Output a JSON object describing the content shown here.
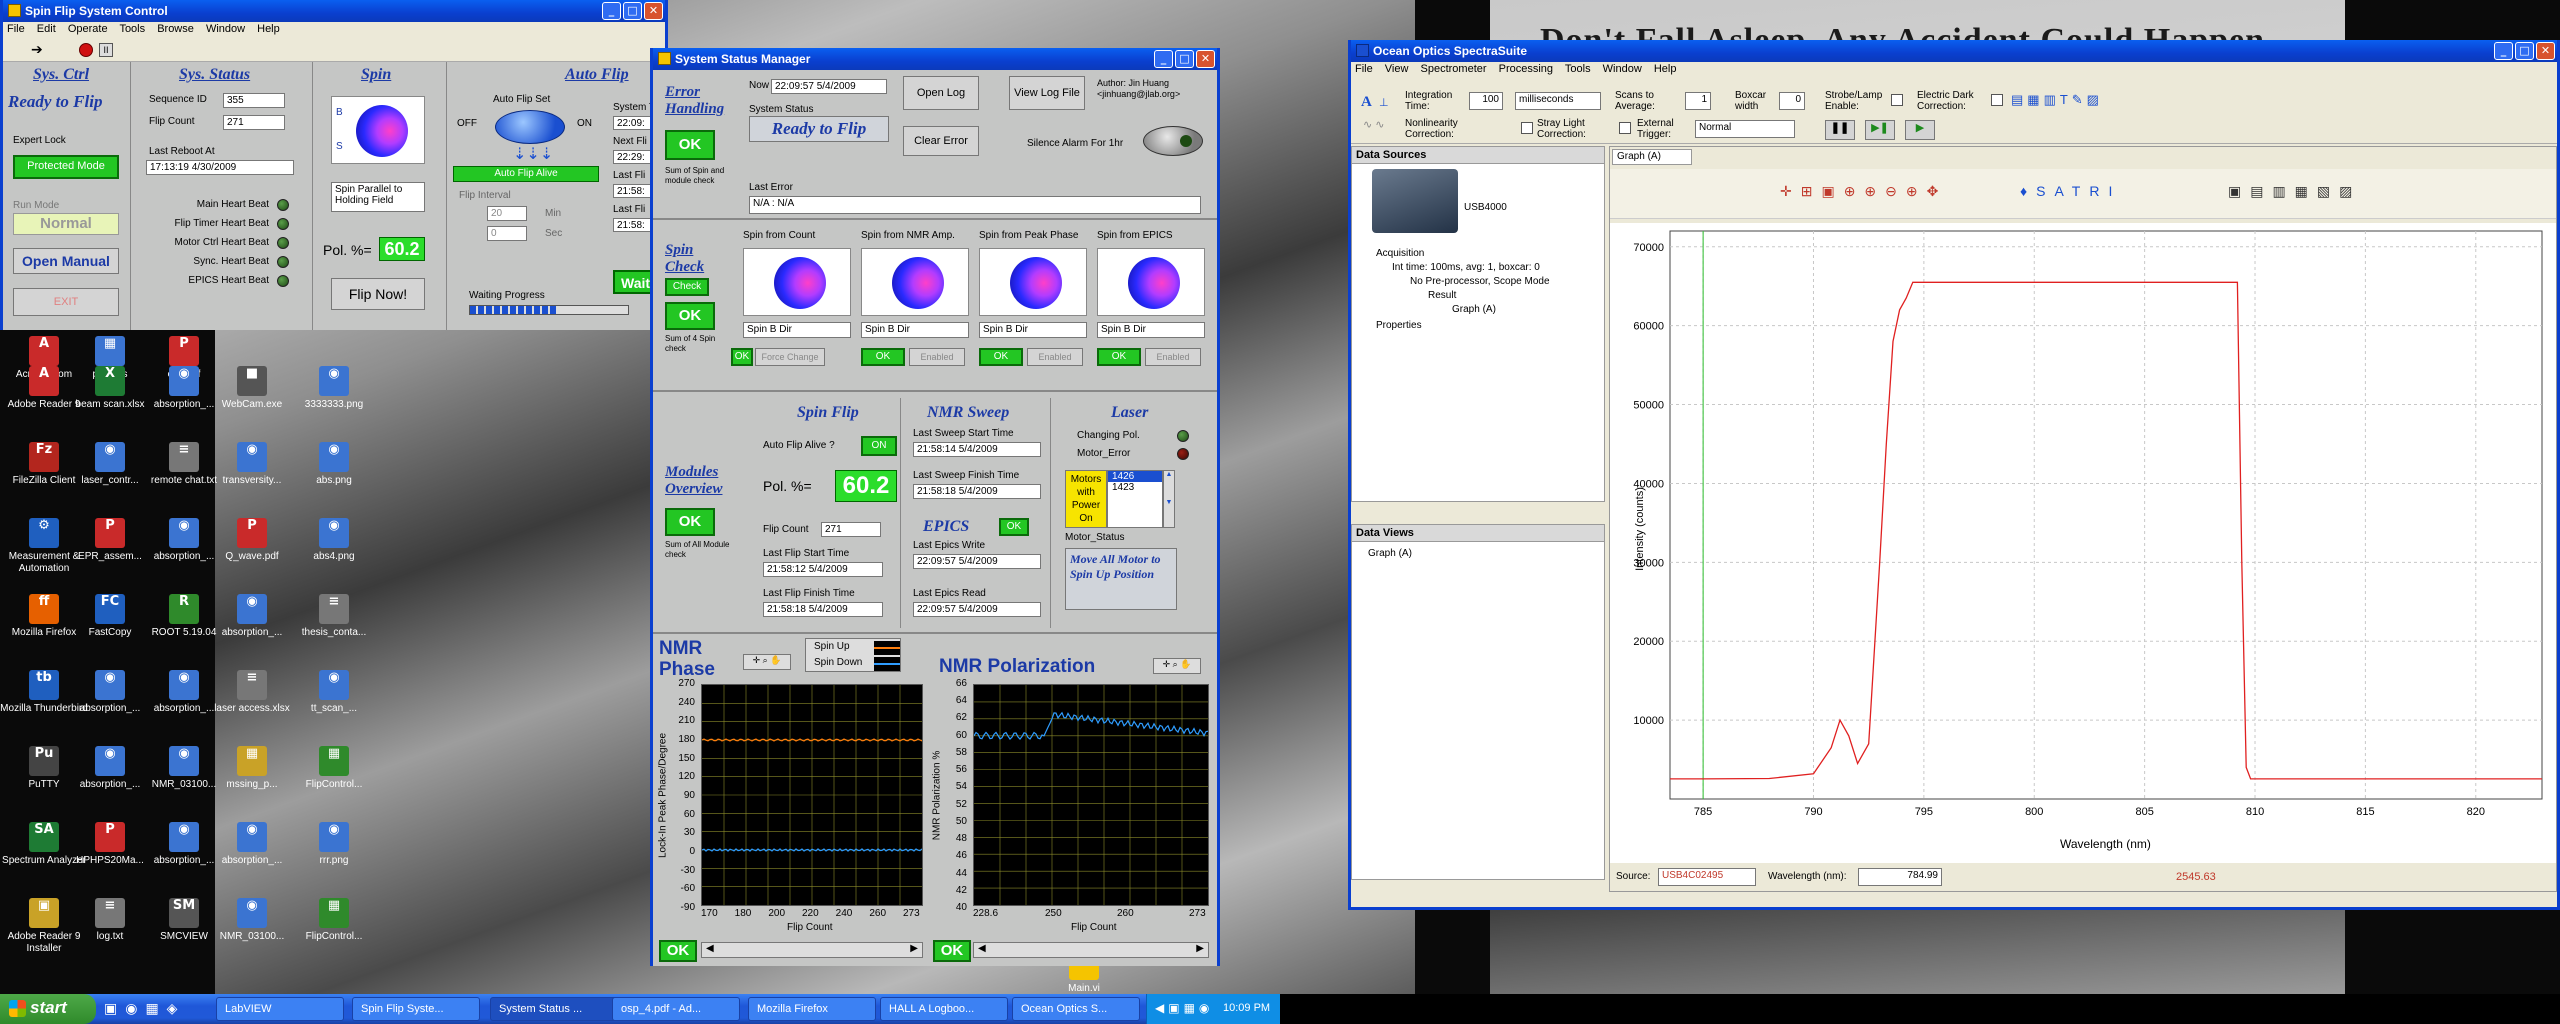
{
  "desktop": {
    "poster_text": "Don't Fall Asleep, Any Accident Could Happen",
    "icons": [
      {
        "label": "Acrobat.com",
        "glyph": "A",
        "color": "#c92a2a"
      },
      {
        "label": "pictures",
        "glyph": "▦",
        "color": "#3b74d1"
      },
      {
        "label": "osp.pdf",
        "glyph": "P",
        "color": "#c92a2a"
      },
      {
        "label": "Adobe Reader 9",
        "glyph": "A",
        "color": "#c92a2a"
      },
      {
        "label": "beam scan.xlsx",
        "glyph": "X",
        "color": "#1e7b34"
      },
      {
        "label": "absorption_...",
        "glyph": "◉",
        "color": "#3b74d1"
      },
      {
        "label": "WebCam.exe",
        "glyph": "■",
        "color": "#555555"
      },
      {
        "label": "3333333.png",
        "glyph": "◉",
        "color": "#3b74d1"
      },
      {
        "label": "FileZilla Client",
        "glyph": "Fz",
        "color": "#b3261e"
      },
      {
        "label": "laser_contr...",
        "glyph": "◉",
        "color": "#3b74d1"
      },
      {
        "label": "remote chat.txt",
        "glyph": "≡",
        "color": "#777777"
      },
      {
        "label": "transversity...",
        "glyph": "◉",
        "color": "#3b74d1"
      },
      {
        "label": "abs.png",
        "glyph": "◉",
        "color": "#3b74d1"
      },
      {
        "label": "Measurement & Automation",
        "glyph": "⚙",
        "color": "#1f5fbf"
      },
      {
        "label": "EPR_assem...",
        "glyph": "P",
        "color": "#c92a2a"
      },
      {
        "label": "absorption_...",
        "glyph": "◉",
        "color": "#3b74d1"
      },
      {
        "label": "Q_wave.pdf",
        "glyph": "P",
        "color": "#c92a2a"
      },
      {
        "label": "abs4.png",
        "glyph": "◉",
        "color": "#3b74d1"
      },
      {
        "label": "Mozilla Firefox",
        "glyph": "ff",
        "color": "#e66000"
      },
      {
        "label": "FastCopy",
        "glyph": "FC",
        "color": "#1f5fbf"
      },
      {
        "label": "ROOT 5.19.04",
        "glyph": "R",
        "color": "#2f8a2b"
      },
      {
        "label": "absorption_...",
        "glyph": "◉",
        "color": "#3b74d1"
      },
      {
        "label": "thesis_conta...",
        "glyph": "≡",
        "color": "#777777"
      },
      {
        "label": "Mozilla Thunderbird",
        "glyph": "tb",
        "color": "#1f5fbf"
      },
      {
        "label": "absorption_...",
        "glyph": "◉",
        "color": "#3b74d1"
      },
      {
        "label": "absorption_...",
        "glyph": "◉",
        "color": "#3b74d1"
      },
      {
        "label": "laser access.xlsx",
        "glyph": "≡",
        "color": "#777777"
      },
      {
        "label": "tt_scan_...",
        "glyph": "◉",
        "color": "#3b74d1"
      },
      {
        "label": "PuTTY",
        "glyph": "Pu",
        "color": "#444444"
      },
      {
        "label": "absorption_...",
        "glyph": "◉",
        "color": "#3b74d1"
      },
      {
        "label": "NMR_03100...",
        "glyph": "◉",
        "color": "#3b74d1"
      },
      {
        "label": "mssing_p...",
        "glyph": "▦",
        "color": "#c9a227"
      },
      {
        "label": "FlipControl...",
        "glyph": "▦",
        "color": "#2f8a2b"
      },
      {
        "label": "Spectrum Analyzer",
        "glyph": "SA",
        "color": "#1e7b34"
      },
      {
        "label": "HPHPS20Ma...",
        "glyph": "P",
        "color": "#c92a2a"
      },
      {
        "label": "absorption_...",
        "glyph": "◉",
        "color": "#3b74d1"
      },
      {
        "label": "absorption_...",
        "glyph": "◉",
        "color": "#3b74d1"
      },
      {
        "label": "rrr.png",
        "glyph": "◉",
        "color": "#3b74d1"
      },
      {
        "label": "Adobe Reader 9 Installer",
        "glyph": "▣",
        "color": "#c9a227"
      },
      {
        "label": "log.txt",
        "glyph": "≡",
        "color": "#777777"
      },
      {
        "label": "SMCVIEW",
        "glyph": "SM",
        "color": "#555555"
      },
      {
        "label": "NMR_03100...",
        "glyph": "◉",
        "color": "#3b74d1"
      },
      {
        "label": "FlipControl...",
        "glyph": "▦",
        "color": "#2f8a2b"
      },
      {
        "label": "Main.vi",
        "glyph": "▦",
        "color": "#f5c400"
      }
    ]
  },
  "taskbar": {
    "start_label": "start",
    "tasks": [
      "LabVIEW",
      "Spin Flip Syste...",
      "System Status ...",
      "osp_4.pdf - Ad...",
      "Mozilla Firefox",
      "HALL A Logboo...",
      "Ocean Optics S..."
    ],
    "clock": "10:09 PM"
  },
  "spin_flip_window": {
    "title": "Spin Flip System Control",
    "menu": [
      "File",
      "Edit",
      "Operate",
      "Tools",
      "Browse",
      "Window",
      "Help"
    ],
    "sys_ctrl": {
      "heading": "Sys. Ctrl",
      "status": "Ready to Flip",
      "expert_lock_label": "Expert Lock",
      "protected_mode": "Protected Mode",
      "run_mode_label": "Run Mode",
      "run_mode_value": "Normal",
      "open_manual": "Open Manual",
      "exit": "EXIT"
    },
    "sys_status": {
      "heading": "Sys. Status",
      "sequence_id_label": "Sequence ID",
      "sequence_id": "355",
      "flip_count_label": "Flip Count",
      "flip_count": "271",
      "last_reboot_label": "Last Reboot At",
      "last_reboot": "17:13:19 4/30/2009",
      "heartbeats": [
        "Main Heart Beat",
        "Flip Timer Heart Beat",
        "Motor Ctrl Heart Beat",
        "Sync. Heart Beat",
        "EPICS Heart Beat"
      ]
    },
    "spin": {
      "heading": "Spin",
      "caption": "Spin Parallel to Holding Field",
      "pol_label": "Pol. %=",
      "pol_value": "60.2",
      "flip_now": "Flip Now!"
    },
    "auto_flip": {
      "heading": "Auto Flip",
      "auto_flip_set": "Auto Flip Set",
      "off": "OFF",
      "on": "ON",
      "alive": "Auto Flip Alive",
      "flip_interval": "Flip Interval",
      "interval_min": "20",
      "min_unit": "Min",
      "interval_sec": "0",
      "sec_unit": "Sec",
      "waiting_progress": "Waiting Progress",
      "progress_fraction": 0.55,
      "side_labels": [
        "System T",
        "22:09:",
        "Next Fli",
        "22:29:",
        "Last Fli",
        "21:58:",
        "Last Fli",
        "21:58:"
      ],
      "wait_button": "Wait"
    }
  },
  "status_window": {
    "title": "System Status Manager",
    "now_label": "Now",
    "now_value": "22:09:57 5/4/2009",
    "system_status_label": "System Status",
    "system_status_value": "Ready to Flip",
    "open_log": "Open Log",
    "view_log_file": "View Log File",
    "author": "Author: Jin Huang <jinhuang@jlab.org>",
    "clear_error": "Clear Error",
    "silence_alarm": "Silence Alarm For 1hr",
    "last_error_label": "Last Error",
    "last_error_value": "N/A : N/A",
    "error_handling": {
      "title": "Error Handling",
      "ok": "OK",
      "sub": "Sum of Spin and module check"
    },
    "spin_check": {
      "title": "Spin Check",
      "check": "Check",
      "ok": "OK",
      "sub": "Sum of 4 Spin check",
      "panels": [
        {
          "label": "Spin from Count",
          "dir": "Spin B Dir"
        },
        {
          "label": "Spin from NMR Amp.",
          "dir": "Spin B Dir"
        },
        {
          "label": "Spin from Peak Phase",
          "dir": "Spin B Dir"
        },
        {
          "label": "Spin from EPICS",
          "dir": "Spin B Dir"
        }
      ],
      "force_change": "Force Change",
      "enabled": "Enabled",
      "ok_small": "OK"
    },
    "modules": {
      "title": "Modules Overview",
      "ok": "OK",
      "sub": "Sum of All Module check"
    },
    "spin_flip": {
      "title": "Spin Flip",
      "auto_alive_label": "Auto Flip Alive ?",
      "auto_alive_value": "ON",
      "pol_label": "Pol. %=",
      "pol_value": "60.2",
      "flip_count_label": "Flip Count",
      "flip_count": "271",
      "last_start_label": "Last Flip Start Time",
      "last_start": "21:58:12 5/4/2009",
      "last_finish_label": "Last Flip Finish Time",
      "last_finish": "21:58:18 5/4/2009"
    },
    "nmr_sweep": {
      "title": "NMR Sweep",
      "start_label": "Last Sweep Start Time",
      "start": "21:58:14 5/4/2009",
      "finish_label": "Last Sweep Finish Time",
      "finish": "21:58:18 5/4/2009"
    },
    "epics": {
      "title": "EPICS",
      "ok": "OK",
      "write_label": "Last Epics Write",
      "write": "22:09:57 5/4/2009",
      "read_label": "Last Epics Read",
      "read": "22:09:57 5/4/2009"
    },
    "laser": {
      "title": "Laser",
      "changing_pol": "Changing Pol.",
      "motor_error": "Motor_Error",
      "motors_label": "Motors with Power On",
      "motor_values": [
        "1426",
        "1423"
      ],
      "motor_status": "Motor_Status",
      "move_all": "Move All Motor to Spin Up Position"
    },
    "nmr_phase": {
      "title": "NMR Phase",
      "legend": [
        "Spin Up",
        "Spin Down"
      ],
      "ylabel": "Lock-In Peak Phase/Degree",
      "xlabel": "Flip Count",
      "yticks": [
        "270",
        "240",
        "210",
        "180",
        "150",
        "120",
        "90",
        "60",
        "30",
        "0",
        "-30",
        "-60",
        "-90"
      ],
      "xticks": [
        "170",
        "180",
        "200",
        "220",
        "240",
        "260",
        "273"
      ],
      "ok": "OK"
    },
    "nmr_pol": {
      "title": "NMR Polarization",
      "ylabel": "NMR Polarization %",
      "xlabel": "Flip Count",
      "yticks": [
        "66",
        "64",
        "62",
        "60",
        "58",
        "56",
        "54",
        "52",
        "50",
        "48",
        "46",
        "44",
        "42",
        "40"
      ],
      "xticks": [
        "228.6",
        "250",
        "260",
        "273"
      ],
      "ok": "OK"
    }
  },
  "spectrasuite": {
    "title": "Ocean Optics SpectraSuite",
    "menu": [
      "File",
      "View",
      "Spectrometer",
      "Processing",
      "Tools",
      "Window",
      "Help"
    ],
    "toolbar": {
      "integration_label": "Integration Time:",
      "integration_value": "100",
      "integration_unit": "milliseconds",
      "scans_label": "Scans to Average:",
      "scans_value": "1",
      "boxcar_label": "Boxcar width",
      "boxcar_value": "0",
      "strobe_label": "Strobe/Lamp Enable:",
      "dark_label": "Electric Dark Correction:",
      "nonlinearity_label": "Nonlinearity Correction:",
      "stray_label": "Stray Light Correction:",
      "external_trigger_label": "External Trigger:",
      "trigger_value": "Normal"
    },
    "data_sources_title": "Data Sources",
    "device": "USB4000",
    "tree": [
      "Acquisition",
      "Int time: 100ms, avg: 1, boxcar: 0",
      "No Pre-processor, Scope Mode",
      "Result",
      "Graph (A)",
      "Properties"
    ],
    "data_views_title": "Data Views",
    "data_views_item": "Graph (A)",
    "graph_tab": "Graph (A)",
    "status": {
      "source_label": "Source:",
      "source_value": "USB4C02495",
      "wavelength_label": "Wavelength (nm):",
      "wavelength_value": "784.99",
      "reading": "2545.63"
    }
  },
  "chart_data": {
    "type": "line",
    "xlabel": "Wavelength (nm)",
    "ylabel": "Intensity (counts)",
    "xlim": [
      783.5,
      823
    ],
    "ylim": [
      0,
      72000
    ],
    "xticks": [
      785,
      790,
      795,
      800,
      805,
      810,
      815,
      820
    ],
    "yticks": [
      10000,
      20000,
      30000,
      40000,
      50000,
      60000,
      70000
    ],
    "grid": true,
    "series": [
      {
        "x": [
          783.5,
          785,
          788,
          790,
          790.8,
          791.2,
          791.6,
          792,
          792.5,
          793,
          793.3,
          793.6,
          793.9,
          794.2,
          794.5,
          795,
          800,
          805,
          809.2,
          809.4,
          809.6,
          809.8,
          812,
          815,
          820,
          823
        ],
        "y": [
          2545,
          2545,
          2600,
          3200,
          6500,
          10000,
          8000,
          4500,
          7000,
          30000,
          45000,
          58000,
          62000,
          63500,
          65500,
          65500,
          65500,
          65500,
          65500,
          30000,
          4000,
          2545,
          2545,
          2545,
          2545,
          2545
        ]
      }
    ],
    "cursor_x": 785
  }
}
